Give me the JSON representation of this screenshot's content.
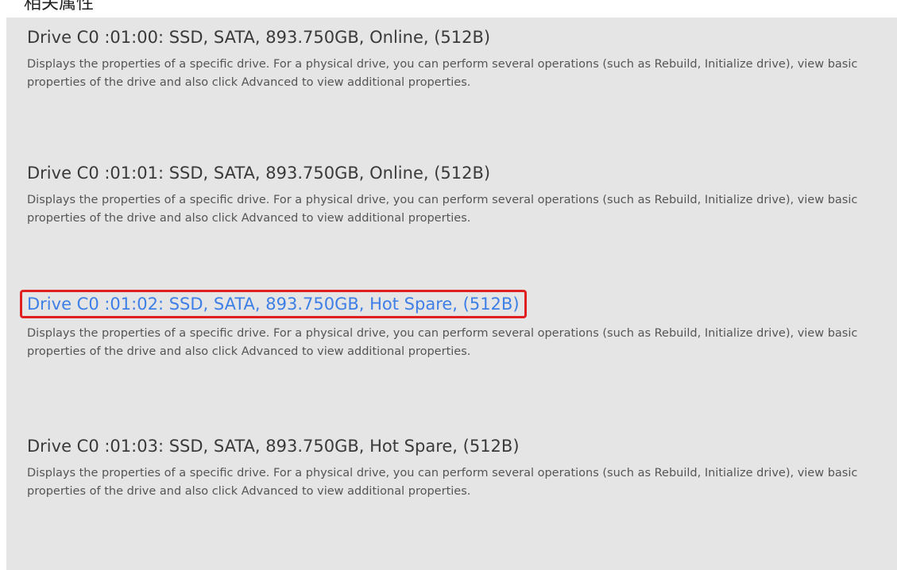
{
  "top_strip": {
    "text": "相关属性"
  },
  "drives": [
    {
      "title": "Drive C0  :01:00: SSD, SATA, 893.750GB, Online, (512B)",
      "description": "Displays the properties of a specific drive. For a physical drive, you can perform several operations (such as Rebuild, Initialize drive), view basic properties of the drive and also click Advanced to view additional properties.",
      "highlighted": false
    },
    {
      "title": "Drive C0  :01:01: SSD, SATA, 893.750GB, Online, (512B)",
      "description": "Displays the properties of a specific drive. For a physical drive, you can perform several operations (such as Rebuild, Initialize drive), view basic properties of the drive and also click Advanced to view additional properties.",
      "highlighted": false
    },
    {
      "title": "Drive C0  :01:02: SSD, SATA, 893.750GB, Hot Spare, (512B)",
      "description": "Displays the properties of a specific drive. For a physical drive, you can perform several operations (such as Rebuild, Initialize drive), view basic properties of the drive and also click Advanced to view additional properties.",
      "highlighted": true
    },
    {
      "title": "Drive C0  :01:03: SSD, SATA, 893.750GB, Hot Spare, (512B)",
      "description": "Displays the properties of a specific drive. For a physical drive, you can perform several operations (such as Rebuild, Initialize drive), view basic properties of the drive and also click Advanced to view additional properties.",
      "highlighted": false
    }
  ],
  "colors": {
    "panel_background": "#e5e5e5",
    "title_text": "#3a3a3a",
    "selected_link": "#3d7fe6",
    "highlight_box": "#e02020",
    "description_text": "#555555"
  }
}
